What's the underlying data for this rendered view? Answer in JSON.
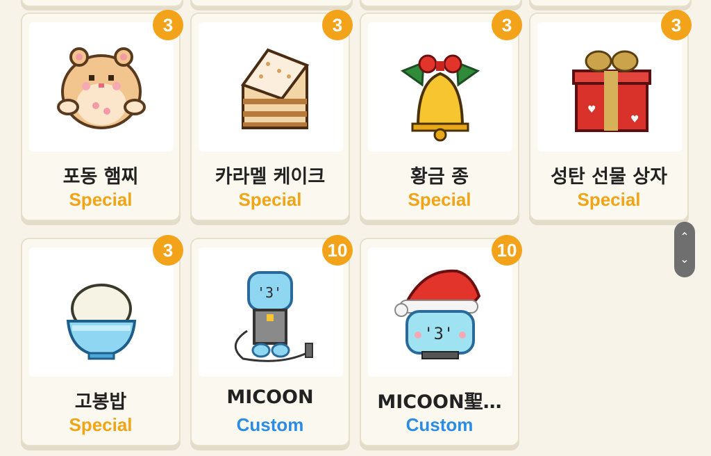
{
  "items": [
    {
      "name": "포동 햄찌",
      "tag": "Special",
      "badge": "3",
      "icon": "hamster-icon"
    },
    {
      "name": "카라멜 케이크",
      "tag": "Special",
      "badge": "3",
      "icon": "cake-icon"
    },
    {
      "name": "황금 종",
      "tag": "Special",
      "badge": "3",
      "icon": "golden-bell-icon"
    },
    {
      "name": "성탄 선물 상자",
      "tag": "Special",
      "badge": "3",
      "icon": "gift-box-icon"
    },
    {
      "name": "고봉밥",
      "tag": "Special",
      "badge": "3",
      "icon": "rice-bowl-icon"
    },
    {
      "name": "MICOON",
      "tag": "Custom",
      "badge": "10",
      "icon": "micoon-robot-icon"
    },
    {
      "name": "MICOON聖…",
      "tag": "Custom",
      "badge": "10",
      "icon": "micoon-santa-icon"
    }
  ],
  "colors": {
    "special": "#f0a416",
    "custom": "#2a8de3",
    "badge": "#f3a31a"
  },
  "scroll": {
    "up_icon": "chevron-up-icon",
    "down_icon": "chevron-down-icon"
  }
}
